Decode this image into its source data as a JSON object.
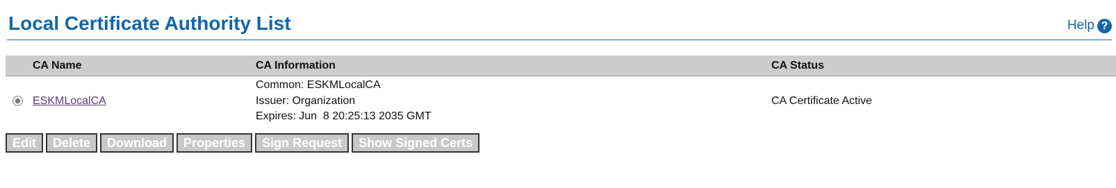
{
  "header": {
    "title": "Local Certificate Authority List",
    "help_label": "Help",
    "help_icon": "question-circle-icon"
  },
  "table": {
    "columns": [
      "CA Name",
      "CA Information",
      "CA Status"
    ],
    "rows": [
      {
        "selected": true,
        "name": "ESKMLocalCA",
        "info": [
          "Common: ESKMLocalCA",
          "Issuer: Organization",
          "Expires: Jun  8 20:25:13 2035 GMT"
        ],
        "status": "CA Certificate Active"
      }
    ]
  },
  "buttons": {
    "edit": "Edit",
    "delete": "Delete",
    "download": "Download",
    "properties": "Properties",
    "sign_request": "Sign Request",
    "show_signed_certs": "Show Signed Certs"
  },
  "colors": {
    "title": "#1565a8",
    "header_bg": "#cccccc",
    "button_bg": "#c8c8c8",
    "link": "#5a3d6e"
  }
}
